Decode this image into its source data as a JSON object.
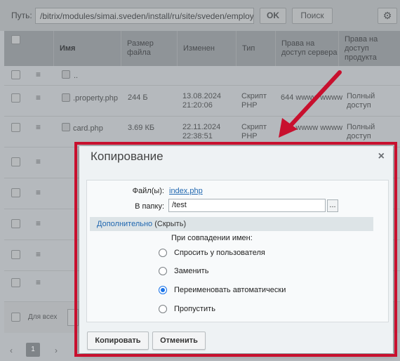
{
  "toolbar": {
    "path_label": "Путь:",
    "path_value": "/bitrix/modules/simai.sveden/install/ru/site/sveden/employees",
    "ok_label": "OK",
    "search_label": "Поиск"
  },
  "table": {
    "columns": [
      "Имя",
      "Размер файла",
      "Изменен",
      "Тип",
      "Права на доступ сервера",
      "Права на доступ продукта"
    ],
    "rows": [
      {
        "name": "..",
        "size": "",
        "modified": "",
        "type": "",
        "server_rights": "",
        "product_rights": ""
      },
      {
        "name": ".property.php",
        "size": "244 Б",
        "modified": "13.08.2024 21:20:06",
        "type": "Скрипт PHP",
        "server_rights": "644 wwww wwww",
        "product_rights": "Полный доступ"
      },
      {
        "name": "card.php",
        "size": "3.69 КБ",
        "modified": "22.11.2024 22:38:51",
        "type": "Скрипт PHP",
        "server_rights": "644 wwww wwww",
        "product_rights": "Полный доступ"
      }
    ]
  },
  "footer": {
    "select_all_label": "Для всех"
  },
  "pager": {
    "current_page": "1"
  },
  "dialog": {
    "title": "Копирование",
    "files_label": "Файл(ы):",
    "files_value": "index.php",
    "folder_label": "В папку:",
    "folder_value": "/test",
    "browse_label": "...",
    "advanced_link": "Дополнительно",
    "advanced_toggle": "(Скрыть)",
    "conflict_label": "При совпадении имен:",
    "options": [
      {
        "label": "Спросить у пользователя",
        "selected": false
      },
      {
        "label": "Заменить",
        "selected": false
      },
      {
        "label": "Переименовать автоматически",
        "selected": true
      },
      {
        "label": "Пропустить",
        "selected": false
      }
    ],
    "copy_button": "Копировать",
    "cancel_button": "Отменить"
  },
  "colors": {
    "highlight": "#c8102e",
    "link": "#2067b0"
  }
}
